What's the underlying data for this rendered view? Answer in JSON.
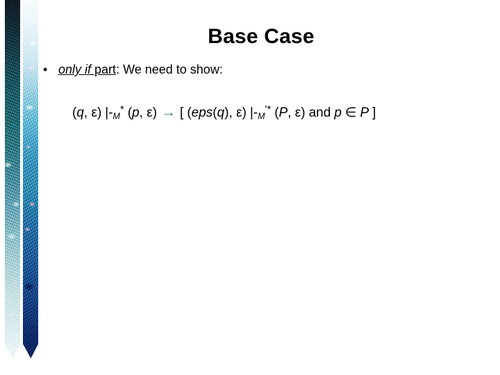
{
  "slide": {
    "title": "Base Case",
    "background_color": "#ffffff",
    "text_color": "#000000"
  },
  "decoration": {
    "name": "floral-border-strips",
    "strip_count": 2,
    "strip_a_colors": [
      "#141c24",
      "#2b6f72",
      "#9cc2c8",
      "#eef7f8",
      "#7a1f38"
    ],
    "strip_b_colors": [
      "#f7fbfc",
      "#7fc0d6",
      "#1f4f86",
      "#0e2356",
      "#e8649a"
    ]
  },
  "bullet": {
    "marker": "•",
    "emphasis_italic": "only if",
    "emphasis_plain": " part",
    "rest": ": We need to show:"
  },
  "formula": {
    "full_text": "(q, ε) |-M* (p, ε)  →  [ (eps(q), ε) |-M'* (P, ε) and p ∈ P ]",
    "lhs": {
      "open": "(",
      "state": "q",
      "comma": ", ",
      "epsilon": "ε",
      "close": ")",
      "turnstile": "|-",
      "machine": "M",
      "star": "*",
      "open2": "(",
      "state2": "p",
      "comma2": ", ",
      "epsilon2": "ε",
      "close2": ")"
    },
    "arrow": "→",
    "arrow_color": "#4a8288",
    "rhs": {
      "open_bracket": "[",
      "open": "(",
      "fn": "eps",
      "fn_open": "(",
      "fn_arg": "q",
      "fn_close": ")",
      "comma": ", ",
      "epsilon": "ε",
      "close": ")",
      "turnstile": "|-",
      "machine": "M",
      "prime_star": "'*",
      "open2": "(",
      "set": "P",
      "comma2": ", ",
      "epsilon2": "ε",
      "close2": ")",
      "and": "and",
      "member_left": "p",
      "member_symbol": "∈",
      "member_right": "P",
      "close_bracket": "]"
    }
  }
}
